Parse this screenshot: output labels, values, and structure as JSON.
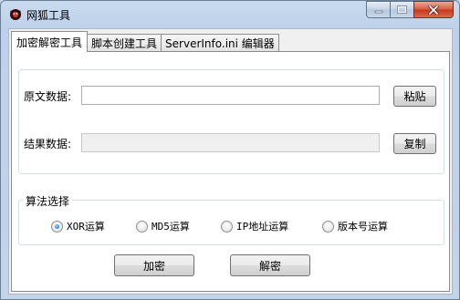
{
  "window": {
    "title": "网狐工具"
  },
  "tabs": [
    {
      "label": "加密解密工具",
      "active": true
    },
    {
      "label": "脚本创建工具",
      "active": false
    },
    {
      "label": "ServerInfo.ini 编辑器",
      "active": false
    }
  ],
  "data_group": {
    "source_label": "原文数据:",
    "source_value": "",
    "paste_label": "粘贴",
    "result_label": "结果数据:",
    "result_value": "",
    "copy_label": "复制"
  },
  "algorithm": {
    "title": "算法选择",
    "options": [
      {
        "label": "XOR运算",
        "selected": true
      },
      {
        "label": "MD5运算",
        "selected": false
      },
      {
        "label": "IP地址运算",
        "selected": false
      },
      {
        "label": "版本号运算",
        "selected": false
      }
    ]
  },
  "actions": {
    "encrypt_label": "加密",
    "decrypt_label": "解密"
  },
  "colors": {
    "frame": "#c2d4ea",
    "close_button": "#c7371b",
    "radio_selected": "#1a5fa8"
  }
}
